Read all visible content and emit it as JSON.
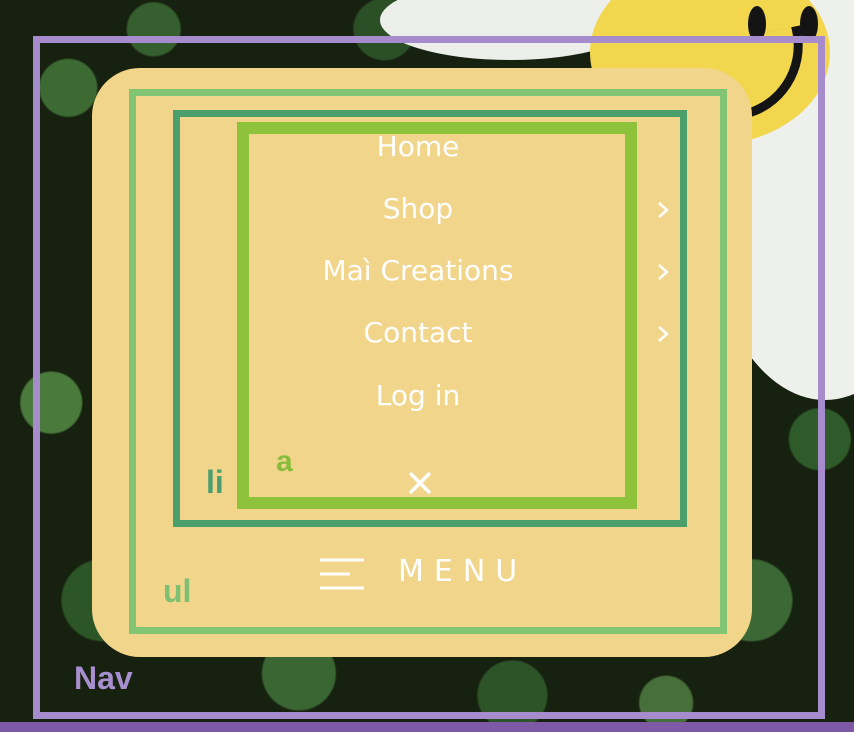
{
  "nav": {
    "items": [
      {
        "label": "Home",
        "has_submenu": false
      },
      {
        "label": "Shop",
        "has_submenu": true
      },
      {
        "label": "Maì Creations",
        "has_submenu": true
      },
      {
        "label": "Contact",
        "has_submenu": true
      },
      {
        "label": "Log in",
        "has_submenu": false
      }
    ],
    "close_icon": "close-icon",
    "menu_label": "MENU",
    "menu_icon": "hamburger-icon"
  },
  "annotations": {
    "nav": "Nav",
    "ul": "ul",
    "li": "li",
    "a": "a"
  },
  "colors": {
    "panel": "#f1d58a",
    "nav_outline": "#a68ccd",
    "ul_outline": "#80c474",
    "li_outline": "#4a9f6d",
    "a_outline": "#8ec23a"
  }
}
